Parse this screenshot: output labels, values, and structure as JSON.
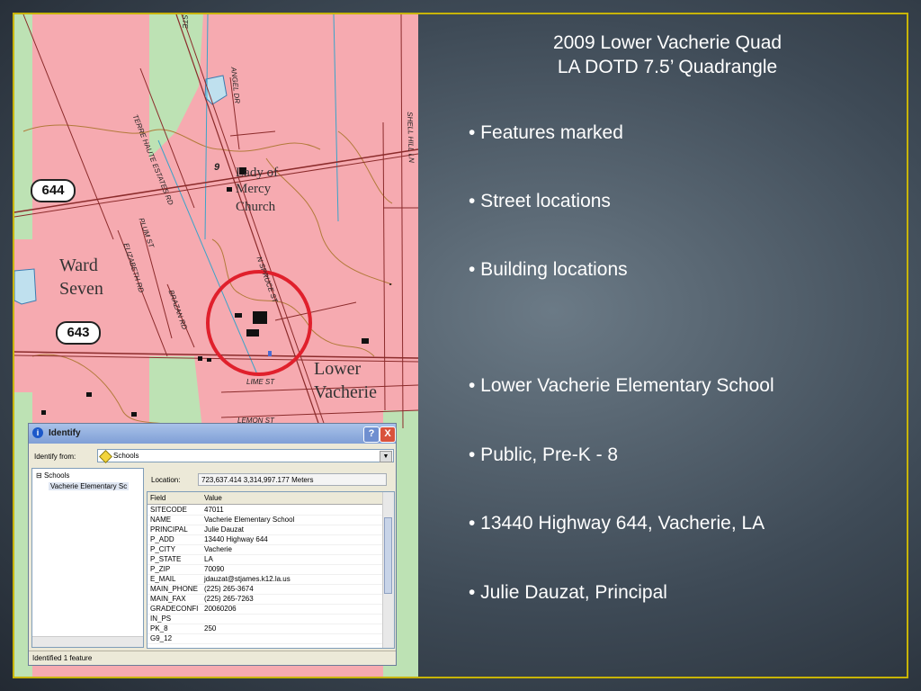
{
  "map": {
    "place_names": [
      "Ward",
      "Seven",
      "Lady of",
      "Mercy",
      "Church",
      "Lower",
      "Vacherie"
    ],
    "highway_shields": [
      "644",
      "643"
    ],
    "streets": [
      "TERRE HAUTE ESTATES RD",
      "ANGEL DR",
      "SHELL HILL LN",
      "PLUM ST",
      "ELIZABETH RD",
      "BRAZAN RD",
      "N SPRUCE ST",
      "LIME ST",
      "LEMON ST",
      "STE"
    ],
    "section_number": "9"
  },
  "slide": {
    "title_line1": "2009 Lower Vacherie Quad",
    "title_line2": "LA DOTD 7.5’ Quadrangle",
    "bullets": [
      "• Features marked",
      "• Street locations",
      "• Building locations",
      "• Lower Vacherie Elementary School",
      "• Public, Pre-K - 8",
      "• 13440 Highway 644, Vacherie, LA",
      "• Julie Dauzat, Principal"
    ]
  },
  "identify": {
    "title": "Identify",
    "help_label": "?",
    "close_label": "X",
    "identify_from_label": "Identify from:",
    "identify_from_value": "Schools",
    "tree_root": "Schools",
    "tree_child": "Vacherie Elementary Sc",
    "location_label": "Location:",
    "location_value": "723,637.414  3,314,997.177 Meters",
    "col_field": "Field",
    "col_value": "Value",
    "rows": [
      {
        "field": "SITECODE",
        "value": "47011"
      },
      {
        "field": "NAME",
        "value": "Vacherie Elementary School"
      },
      {
        "field": "PRINCIPAL",
        "value": "Julie Dauzat"
      },
      {
        "field": "P_ADD",
        "value": "13440 Highway 644"
      },
      {
        "field": "P_CITY",
        "value": "Vacherie"
      },
      {
        "field": "P_STATE",
        "value": "LA"
      },
      {
        "field": "P_ZIP",
        "value": "70090"
      },
      {
        "field": "E_MAIL",
        "value": "jdauzat@stjames.k12.la.us"
      },
      {
        "field": "MAIN_PHONE",
        "value": "(225) 265-3674"
      },
      {
        "field": "MAIN_FAX",
        "value": "(225) 265-7263"
      },
      {
        "field": "GRADECONFI",
        "value": "20060206"
      },
      {
        "field": "IN_PS",
        "value": ""
      },
      {
        "field": "PK_8",
        "value": "250"
      },
      {
        "field": "G9_12",
        "value": ""
      }
    ],
    "status": "Identified 1 feature"
  },
  "colors": {
    "border_gold": "#c8b400",
    "map_pink": "#f6aab0",
    "circle_red": "#e0202c"
  }
}
